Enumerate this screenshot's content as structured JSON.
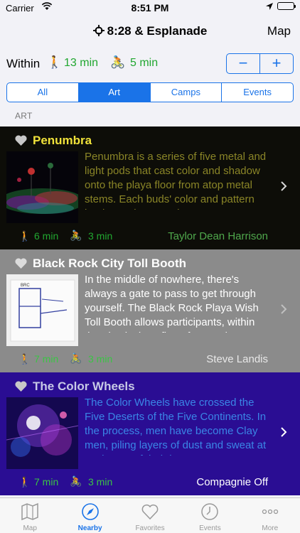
{
  "status_bar": {
    "carrier": "Carrier",
    "time": "8:51 PM"
  },
  "nav": {
    "title": "8:28 & Esplanade",
    "right_button": "Map"
  },
  "within": {
    "label": "Within",
    "walk_time": "13 min",
    "bike_time": "5 min",
    "minus": "−",
    "plus": "+"
  },
  "segments": [
    "All",
    "Art",
    "Camps",
    "Events"
  ],
  "selected_segment": "Art",
  "section_header": "ART",
  "items": [
    {
      "title": "Penumbra",
      "description": "Penumbra is a series of five metal and light pods that cast color and shadow onto the playa floor from atop metal stems. Each buds' color and pattern lends to a large scale...",
      "walk": "6 min",
      "bike": "3 min",
      "host": "Taylor Dean Harrison",
      "background": "#0d0d08"
    },
    {
      "title": "Black Rock City Toll Booth",
      "description": "In the middle of nowhere, there's always a gate to pass to get through yourself. The Black Rock Playa Wish Toll Booth allows participants, within the physical confine of a wooden w...",
      "walk": "7 min",
      "bike": "3 min",
      "host": "Steve Landis",
      "background": "#8b8b8b"
    },
    {
      "title": "The Color Wheels",
      "description": "The Color Wheels have crossed the Five Deserts of the Five Continents. In the process, men have become Clay men, piling layers of dust and sweat at each step of their journey....",
      "walk": "7 min",
      "bike": "3 min",
      "host": "Compagnie Off",
      "background": "#2a0d93"
    }
  ],
  "tabs": [
    {
      "label": "Map",
      "icon": "map-icon"
    },
    {
      "label": "Nearby",
      "icon": "compass-icon"
    },
    {
      "label": "Favorites",
      "icon": "heart-icon"
    },
    {
      "label": "Events",
      "icon": "clock-icon"
    },
    {
      "label": "More",
      "icon": "more-icon"
    }
  ],
  "active_tab": "Nearby",
  "colors": {
    "accent": "#1a73e8",
    "green": "#21a730"
  }
}
